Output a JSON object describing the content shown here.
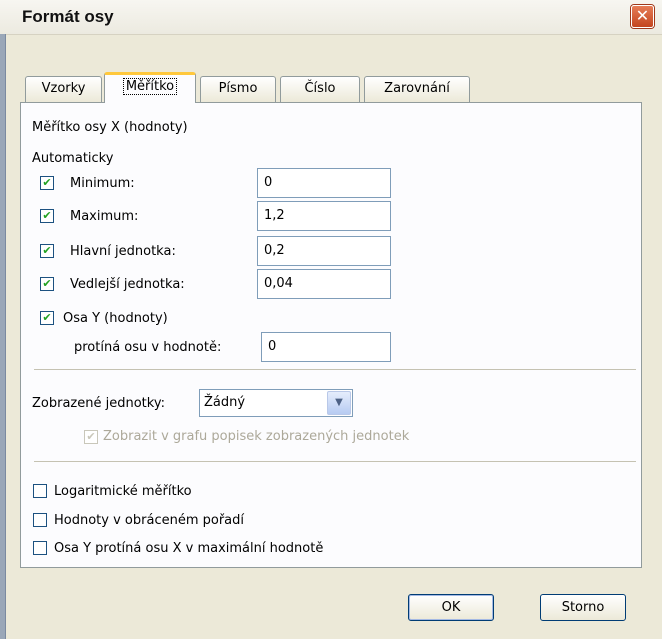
{
  "window": {
    "title": "Formát osy"
  },
  "tabs": [
    "Vzorky",
    "Měřítko",
    "Písmo",
    "Číslo",
    "Zarovnání"
  ],
  "active_tab": "Měřítko",
  "scale": {
    "heading": "Měřítko osy X (hodnoty)",
    "auto_label": "Automaticky",
    "rows": [
      {
        "label": "Minimum:",
        "checked": true,
        "value": "0"
      },
      {
        "label": "Maximum:",
        "checked": true,
        "value": "1,2"
      },
      {
        "label": "Hlavní jednotka:",
        "checked": true,
        "value": "0,2"
      },
      {
        "label": "Vedlejší jednotka:",
        "checked": true,
        "value": "0,04"
      }
    ],
    "cross_axis": {
      "label": "Osa Y (hodnoty)",
      "checked": true
    },
    "cross_value": {
      "label": "protíná osu v hodnotě:",
      "value": "0"
    }
  },
  "display_units": {
    "label": "Zobrazené jednotky:",
    "selected": "Žádný",
    "show_label_checkbox": {
      "label": "Zobrazit v grafu popisek zobrazených jednotek",
      "checked": true,
      "disabled": true
    }
  },
  "options": [
    {
      "label": "Logaritmické měřítko",
      "checked": false
    },
    {
      "label": "Hodnoty v obráceném pořadí",
      "checked": false
    },
    {
      "label": "Osa Y protíná osu X v maximální hodnotě",
      "checked": false
    }
  ],
  "buttons": {
    "ok": "OK",
    "cancel": "Storno"
  },
  "icons": {
    "close": "close-icon",
    "check": "checkmark-icon",
    "dropdown": "chevron-down-icon"
  }
}
